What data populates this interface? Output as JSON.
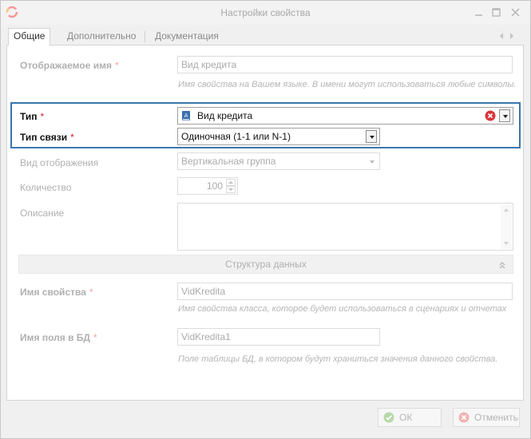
{
  "window": {
    "title": "Настройки свойства",
    "colors": {
      "highlight": "#3a76ae",
      "required": "#d7182a",
      "disabled_text": "#b0b0b0"
    }
  },
  "tabs": [
    {
      "label": "Общие",
      "active": true
    },
    {
      "label": "Дополнительно",
      "active": false
    },
    {
      "label": "Документация",
      "active": false
    }
  ],
  "form": {
    "display_name": {
      "label": "Отображаемое имя",
      "required_mark": "*",
      "value": "Вид кредита",
      "hint": "Имя свойства на Вашем языке. В имени могут использоваться любые символы."
    },
    "type": {
      "label": "Тип",
      "required_mark": "*",
      "value": "Вид кредита",
      "icon": "class-book-icon"
    },
    "link_type": {
      "label": "Тип связи",
      "required_mark": "*",
      "value": "Одиночная (1-1 или N-1)"
    },
    "view_mode": {
      "label": "Вид отображения",
      "value": "Вертикальная группа"
    },
    "quantity": {
      "label": "Количество",
      "value": "100"
    },
    "description": {
      "label": "Описание",
      "value": ""
    }
  },
  "data_structure": {
    "header": "Структура данных",
    "property_name": {
      "label": "Имя свойства",
      "required_mark": "*",
      "value": "VidKredita",
      "hint": "Имя свойства класса, которое будет использоваться в сценариях и отчетах"
    },
    "db_field_name": {
      "label": "Имя поля в БД",
      "required_mark": "*",
      "value": "VidKredita1",
      "hint": "Поле таблицы БД, в котором будут храниться значения данного свойства."
    }
  },
  "footer": {
    "ok_label": "ОК",
    "cancel_label": "Отменить"
  }
}
